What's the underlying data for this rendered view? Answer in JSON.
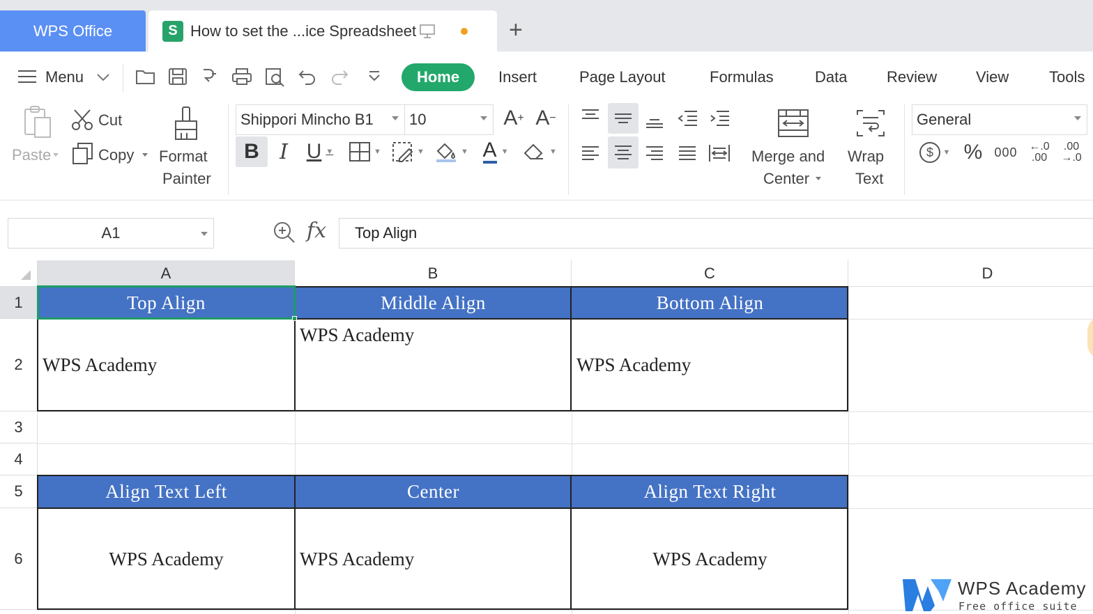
{
  "tabs": {
    "app": "WPS Office",
    "document": "How to set the ...ice Spreadsheet",
    "add": "+"
  },
  "menu": {
    "menu_label": "Menu",
    "items": [
      "Home",
      "Insert",
      "Page Layout",
      "Formulas",
      "Data",
      "Review",
      "View",
      "Tools"
    ]
  },
  "ribbon": {
    "paste": "Paste",
    "cut": "Cut",
    "copy": "Copy",
    "format_painter_1": "Format",
    "format_painter_2": "Painter",
    "font_name": "Shippori Mincho B1",
    "font_size": "10",
    "merge_1": "Merge and",
    "merge_2": "Center",
    "wrap_1": "Wrap",
    "wrap_2": "Text",
    "number_format": "General",
    "percent": "%",
    "thousands": "000",
    "inc_decimal": "←.0 .00",
    "dec_decimal": ".00 →.0"
  },
  "formula_bar": {
    "cell_ref": "A1",
    "fx": "fx",
    "value": "Top Align"
  },
  "sheet": {
    "columns": [
      "A",
      "B",
      "C",
      "D"
    ],
    "rows": [
      "1",
      "2",
      "3",
      "4",
      "5",
      "6"
    ],
    "r1": [
      "Top Align",
      "Middle Align",
      "Bottom Align"
    ],
    "r2": [
      "WPS Academy",
      "WPS Academy",
      "WPS Academy"
    ],
    "r5": [
      "Align Text Left",
      "Center",
      "Align Text Right"
    ],
    "r6": [
      "WPS Academy",
      "WPS Academy",
      "WPS Academy"
    ]
  },
  "watermark": {
    "title": "WPS Academy",
    "subtitle": "Free office suite tutorials"
  },
  "colors": {
    "accent_green": "#22a86b",
    "tab_blue": "#5a8ff3",
    "header_fill": "#4472c4",
    "selection": "#1e9c66"
  }
}
